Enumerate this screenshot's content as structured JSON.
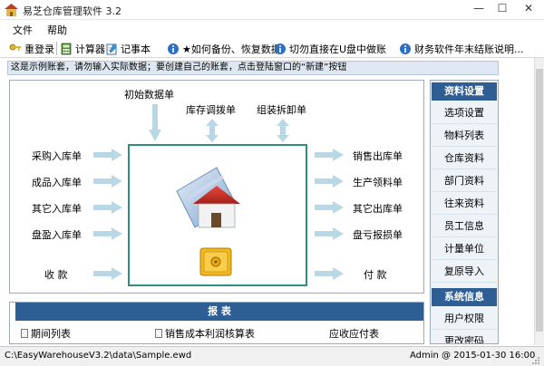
{
  "window": {
    "title": "易芝仓库管理软件 3.2",
    "controls": {
      "minimize": "—",
      "maximize": "☐",
      "close": "✕"
    }
  },
  "menu": {
    "items": [
      "文件",
      "帮助"
    ]
  },
  "toolbar": {
    "items": [
      {
        "label": "重登录",
        "icon": "key-icon"
      },
      {
        "label": "计算器",
        "icon": "calculator-icon"
      },
      {
        "label": "记事本",
        "icon": "notepad-icon"
      },
      {
        "label": "★如何备份、恢复数据",
        "icon": "info-icon"
      },
      {
        "label": "切勿直接在U盘中做账",
        "icon": "warning-icon"
      },
      {
        "label": "财务软件年末结账说明...",
        "icon": "info-icon"
      }
    ]
  },
  "notice": "这是示例账套，请勿输入实际数据；要创建自己的账套，点击登陆窗口的“新建”按钮",
  "flow": {
    "top": [
      "初始数据单",
      "库存调拨单",
      "组装拆卸单"
    ],
    "left": [
      "采购入库单",
      "成品入库单",
      "其它入库单",
      "盘盈入库单",
      "收  款"
    ],
    "right": [
      "销售出库单",
      "生产领料单",
      "其它出库单",
      "盘亏报损单",
      "付  款"
    ]
  },
  "sidebar": {
    "sections": [
      {
        "title": "资料设置",
        "items": [
          "选项设置",
          "物料列表",
          "仓库资料",
          "部门资料",
          "往来资料",
          "员工信息",
          "计量单位",
          "复原导入"
        ]
      },
      {
        "title": "系统信息",
        "items": [
          "用户权限",
          "更改密码"
        ]
      }
    ]
  },
  "report": {
    "title": "报  表",
    "items": [
      "期间列表",
      "销售成本利润核算表",
      "应收应付表"
    ]
  },
  "status": {
    "path": "C:\\EasyWarehouseV3.2\\data\\Sample.ewd",
    "user_time": "Admin @ 2015-01-30 16:00"
  },
  "colors": {
    "accent": "#2f5e94",
    "arrow": "#b8d8e6",
    "frame": "#2f8f7f"
  }
}
